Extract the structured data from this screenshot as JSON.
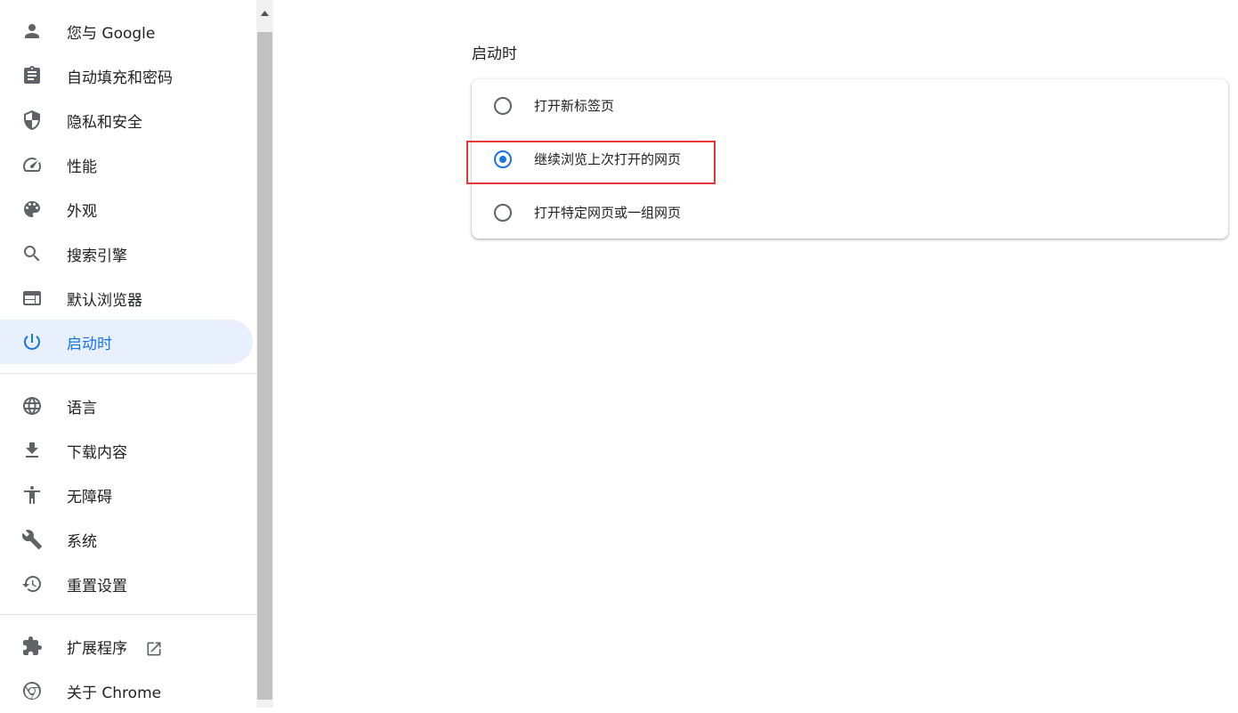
{
  "sidebar": {
    "items": [
      {
        "label": "您与 Google",
        "icon": "person-icon"
      },
      {
        "label": "自动填充和密码",
        "icon": "clipboard-icon"
      },
      {
        "label": "隐私和安全",
        "icon": "shield-icon"
      },
      {
        "label": "性能",
        "icon": "speedometer-icon"
      },
      {
        "label": "外观",
        "icon": "palette-icon"
      },
      {
        "label": "搜索引擎",
        "icon": "search-icon"
      },
      {
        "label": "默认浏览器",
        "icon": "browser-window-icon"
      },
      {
        "label": "启动时",
        "icon": "power-icon",
        "active": true
      },
      {
        "label": "语言",
        "icon": "globe-icon"
      },
      {
        "label": "下载内容",
        "icon": "download-icon"
      },
      {
        "label": "无障碍",
        "icon": "accessibility-icon"
      },
      {
        "label": "系统",
        "icon": "wrench-icon"
      },
      {
        "label": "重置设置",
        "icon": "history-icon"
      },
      {
        "label": "扩展程序",
        "icon": "puzzle-icon",
        "external": true
      },
      {
        "label": "关于 Chrome",
        "icon": "chrome-icon"
      }
    ]
  },
  "main": {
    "section_title": "启动时",
    "options": [
      {
        "label": "打开新标签页",
        "checked": false
      },
      {
        "label": "继续浏览上次打开的网页",
        "checked": true
      },
      {
        "label": "打开特定网页或一组网页",
        "checked": false
      }
    ]
  },
  "colors": {
    "accent": "#1a73e8",
    "active_bg": "#e8f0fe",
    "highlight": "#e53935"
  }
}
